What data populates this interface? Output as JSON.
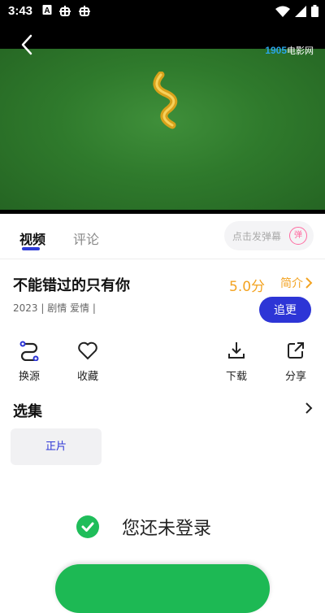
{
  "status_bar": {
    "time": "3:43",
    "icons": [
      "notification-a-icon",
      "bug-icon",
      "bug-icon",
      "wifi-icon",
      "signal-icon",
      "battery-icon"
    ]
  },
  "player": {
    "logo_brand": "1905",
    "logo_text": "电影网"
  },
  "tabs": [
    {
      "label": "视频",
      "active": true
    },
    {
      "label": "评论",
      "active": false
    }
  ],
  "danmu": {
    "placeholder": "点击发弹幕",
    "icon_char": "弹"
  },
  "movie": {
    "title": "不能错过的只有你",
    "score": "5.0分",
    "intro_label": "简介",
    "meta": "2023 | 剧情 爱情 |",
    "follow_label": "追更"
  },
  "actions": [
    {
      "label": "换源",
      "icon": "switch-source-icon"
    },
    {
      "label": "收藏",
      "icon": "heart-icon"
    },
    {
      "label": "下载",
      "icon": "download-icon"
    },
    {
      "label": "分享",
      "icon": "share-icon"
    }
  ],
  "episodes": {
    "section_title": "选集",
    "items": [
      "正片"
    ]
  },
  "login_prompt": {
    "text": "您还未登录"
  },
  "colors": {
    "accent": "#2d35d6",
    "score": "#f3a321",
    "login_green": "#1fbd5a"
  }
}
